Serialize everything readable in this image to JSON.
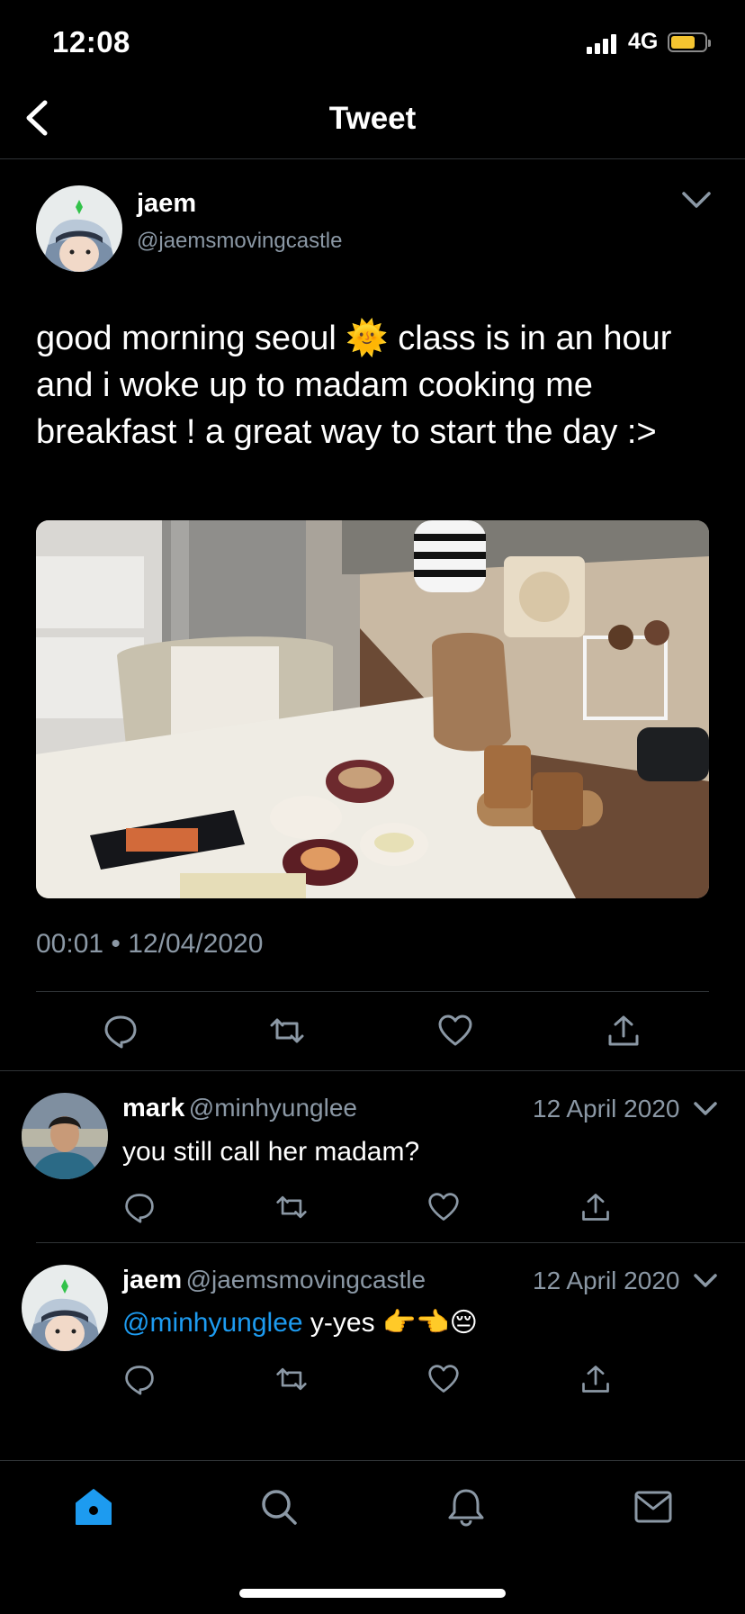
{
  "status": {
    "time": "12:08",
    "network": "4G"
  },
  "nav": {
    "title": "Tweet"
  },
  "tweet": {
    "name": "jaem",
    "handle": "@jaemsmovingcastle",
    "text_before": "good morning seoul",
    "emoji_sun": "🌞",
    "text_after": "class is in an hour and i woke up to madam cooking me breakfast ! a great way to start the day :>",
    "time": "00:01",
    "sep": "•",
    "date": "12/04/2020"
  },
  "replies": [
    {
      "name": "mark",
      "handle": "@minhyunglee",
      "date": "12 April 2020",
      "text": "you still call her madam?"
    },
    {
      "name": "jaem",
      "handle": "@jaemsmovingcastle",
      "date": "12 April 2020",
      "mention": "@minhyunglee",
      "text": "y-yes",
      "emoji": "👉👈😔"
    }
  ],
  "icons": {
    "reply": "reply-icon",
    "retweet": "retweet-icon",
    "like": "heart-icon",
    "share": "share-icon",
    "tabs": [
      "home-icon",
      "search-icon",
      "bell-icon",
      "mail-icon"
    ]
  },
  "colors": {
    "accent": "#1d9bf0",
    "muted": "#8b98a5",
    "background": "#000000",
    "battery": "#f4c430"
  }
}
